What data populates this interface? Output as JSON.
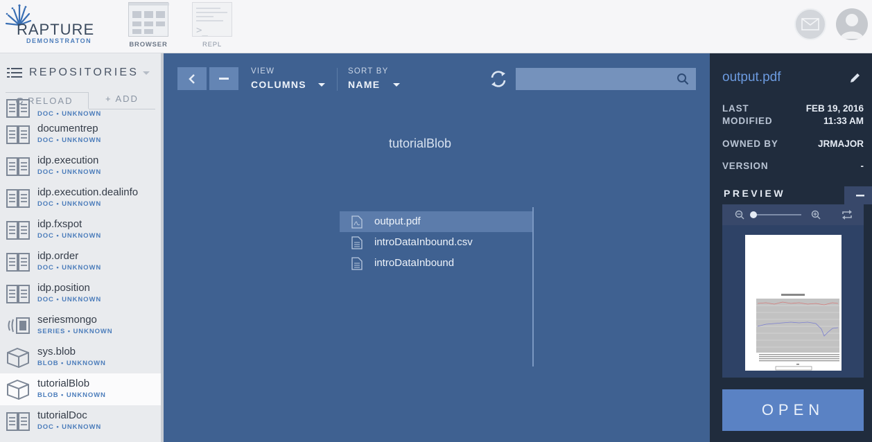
{
  "app": {
    "logo_title": "RAPTURE",
    "logo_subtitle": "DEMONSTRATON",
    "nav": [
      {
        "label": "BROWSER",
        "icon": "browser-icon"
      },
      {
        "label": "REPL",
        "icon": "terminal-icon"
      }
    ]
  },
  "sidebar": {
    "title": "REPOSITORIES",
    "reload_label": "RELOAD",
    "add_label": "+ ADD",
    "items": [
      {
        "name": "",
        "meta": "DOC • UNKNOWN",
        "icon": "document-repo-icon"
      },
      {
        "name": "documentrep",
        "meta": "DOC • UNKNOWN",
        "icon": "document-repo-icon"
      },
      {
        "name": "idp.execution",
        "meta": "DOC • UNKNOWN",
        "icon": "document-repo-icon"
      },
      {
        "name": "idp.execution.dealinfo",
        "meta": "DOC • UNKNOWN",
        "icon": "document-repo-icon"
      },
      {
        "name": "idp.fxspot",
        "meta": "DOC • UNKNOWN",
        "icon": "document-repo-icon"
      },
      {
        "name": "idp.order",
        "meta": "DOC • UNKNOWN",
        "icon": "document-repo-icon"
      },
      {
        "name": "idp.position",
        "meta": "DOC • UNKNOWN",
        "icon": "document-repo-icon"
      },
      {
        "name": "seriesmongo",
        "meta": "SERIES • UNKNOWN",
        "icon": "series-repo-icon"
      },
      {
        "name": "sys.blob",
        "meta": "BLOB • UNKNOWN",
        "icon": "blob-repo-icon"
      },
      {
        "name": "tutorialBlob",
        "meta": "BLOB • UNKNOWN",
        "icon": "blob-repo-icon",
        "selected": true
      },
      {
        "name": "tutorialDoc",
        "meta": "DOC • UNKNOWN",
        "icon": "document-repo-icon"
      }
    ]
  },
  "toolbar": {
    "view_label": "VIEW",
    "view_value": "COLUMNS",
    "sort_label": "SORT BY",
    "sort_value": "NAME",
    "search_value": ""
  },
  "browser": {
    "column_title": "tutorialBlob",
    "files": [
      {
        "name": "output.pdf",
        "icon": "pdf-file-icon",
        "selected": true
      },
      {
        "name": "introDataInbound.csv",
        "icon": "text-file-icon"
      },
      {
        "name": "introDataInbound",
        "icon": "text-file-icon"
      }
    ]
  },
  "details": {
    "title": "output.pdf",
    "last_modified_label": "LAST\nMODIFIED",
    "last_modified_date": "FEB 19, 2016",
    "last_modified_time": "11:33 AM",
    "owned_by_label": "OWNED BY",
    "owned_by_value": "JRMAJOR",
    "version_label": "VERSION",
    "version_value": "-",
    "preview_label": "PREVIEW",
    "preview_zoom": 0,
    "open_label": "OPEN"
  },
  "colors": {
    "main_bg": "#3f6191",
    "panel_bg": "#202c3d",
    "accent": "#4c7dbb",
    "open_button": "#5a82c4"
  }
}
